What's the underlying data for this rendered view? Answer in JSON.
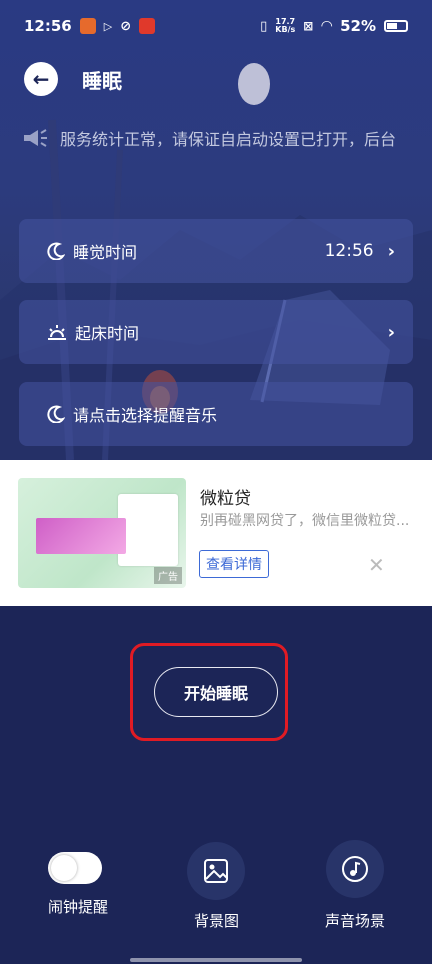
{
  "status_bar": {
    "time": "12:56",
    "net_speed_top": "17.7",
    "net_speed_unit": "KB/s",
    "battery": "52%"
  },
  "header": {
    "title": "睡眠"
  },
  "notice": {
    "text": "服务统计正常，请保证自启动设置已打开，后台"
  },
  "settings": [
    {
      "label": "睡觉时间",
      "value": "12:56",
      "icon": "moon-icon"
    },
    {
      "label": "起床时间",
      "value": "",
      "icon": "sunrise-icon"
    },
    {
      "label": "请点击选择提醒音乐",
      "value": "",
      "icon": "moon-icon"
    }
  ],
  "ad": {
    "title": "微粒贷",
    "description": "别再碰黑网贷了，微信里微粒贷...",
    "button": "查看详情",
    "tag": "广告",
    "close": "✕"
  },
  "start_button": {
    "label": "开始睡眠"
  },
  "bottom": {
    "alarm_label": "闹钟提醒",
    "alarm_on": false,
    "background_label": "背景图",
    "sound_label": "声音场景"
  },
  "colors": {
    "background": "#1c2557",
    "highlight": "#e01b24",
    "ad_button": "#3d6ad6"
  }
}
